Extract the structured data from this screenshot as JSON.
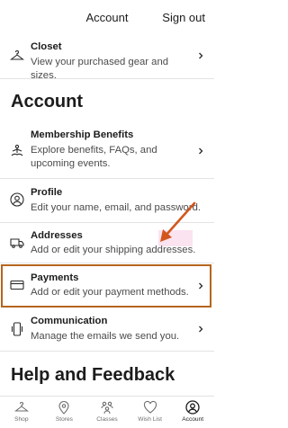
{
  "header": {
    "title": "Account",
    "sign_out": "Sign out"
  },
  "rows": {
    "closet": {
      "title": "Closet",
      "desc": "View your purchased gear and sizes."
    },
    "membership": {
      "title": "Membership Benefits",
      "desc": "Explore benefits, FAQs, and upcoming events."
    },
    "profile": {
      "title": "Profile",
      "desc": "Edit your name, email, and password."
    },
    "addresses": {
      "title": "Addresses",
      "desc": "Add or edit your shipping addresses."
    },
    "payments": {
      "title": "Payments",
      "desc": "Add or edit your payment methods."
    },
    "communication": {
      "title": "Communication",
      "desc": "Manage the emails we send you."
    }
  },
  "sections": {
    "account": "Account",
    "help": "Help and Feedback"
  },
  "tabs": [
    {
      "label": "Shop",
      "icon": "hanger-icon"
    },
    {
      "label": "Stores",
      "icon": "map-pin-icon"
    },
    {
      "label": "Classes",
      "icon": "people-icon"
    },
    {
      "label": "Wish List",
      "icon": "heart-icon"
    },
    {
      "label": "Account",
      "icon": "account-icon"
    }
  ],
  "colors": {
    "accent_outline": "#b5651d",
    "arrow": "#d2561c",
    "highlight": "#fbe3f0"
  }
}
